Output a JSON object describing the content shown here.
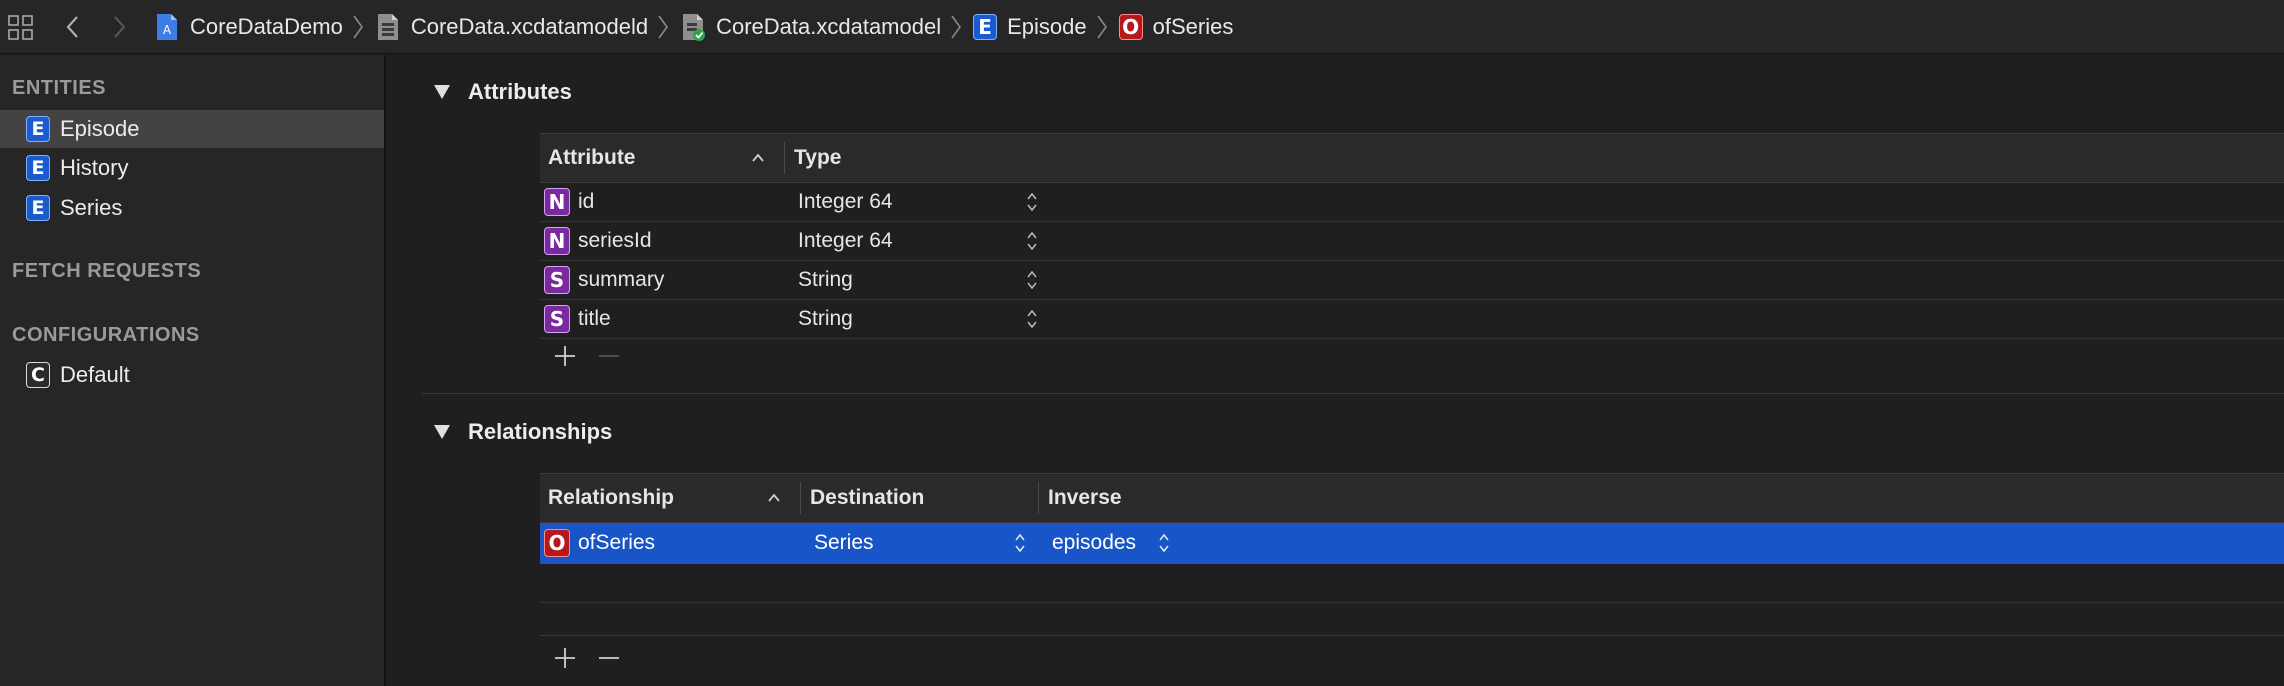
{
  "breadcrumb": {
    "items": [
      {
        "label": "CoreDataDemo",
        "icon": "project-icon"
      },
      {
        "label": "CoreData.xcdatamodeld",
        "icon": "datamodel-bundle-icon"
      },
      {
        "label": "CoreData.xcdatamodel",
        "icon": "datamodel-file-icon"
      },
      {
        "label": "Episode",
        "icon": "entity-icon",
        "badge": "E"
      },
      {
        "label": "ofSeries",
        "icon": "relationship-icon",
        "badge": "O"
      }
    ]
  },
  "sidebar": {
    "entities_header": "ENTITIES",
    "entities": [
      {
        "badge": "E",
        "label": "Episode",
        "selected": true
      },
      {
        "badge": "E",
        "label": "History",
        "selected": false
      },
      {
        "badge": "E",
        "label": "Series",
        "selected": false
      }
    ],
    "fetch_header": "FETCH REQUESTS",
    "config_header": "CONFIGURATIONS",
    "configurations": [
      {
        "badge": "C",
        "label": "Default"
      }
    ]
  },
  "attributes": {
    "title": "Attributes",
    "columns": {
      "attribute": "Attribute",
      "type": "Type"
    },
    "rows": [
      {
        "badge": "N",
        "name": "id",
        "type": "Integer 64"
      },
      {
        "badge": "N",
        "name": "seriesId",
        "type": "Integer 64"
      },
      {
        "badge": "S",
        "name": "summary",
        "type": "String"
      },
      {
        "badge": "S",
        "name": "title",
        "type": "String"
      }
    ]
  },
  "relationships": {
    "title": "Relationships",
    "columns": {
      "relationship": "Relationship",
      "destination": "Destination",
      "inverse": "Inverse"
    },
    "rows": [
      {
        "badge": "O",
        "name": "ofSeries",
        "destination": "Series",
        "inverse": "episodes",
        "selected": true
      }
    ]
  },
  "colors": {
    "selection": "#1855c9",
    "entity_badge": "#1a5ccf",
    "relationship_badge": "#b5191b",
    "attribute_badge": "#7a2a9f"
  }
}
